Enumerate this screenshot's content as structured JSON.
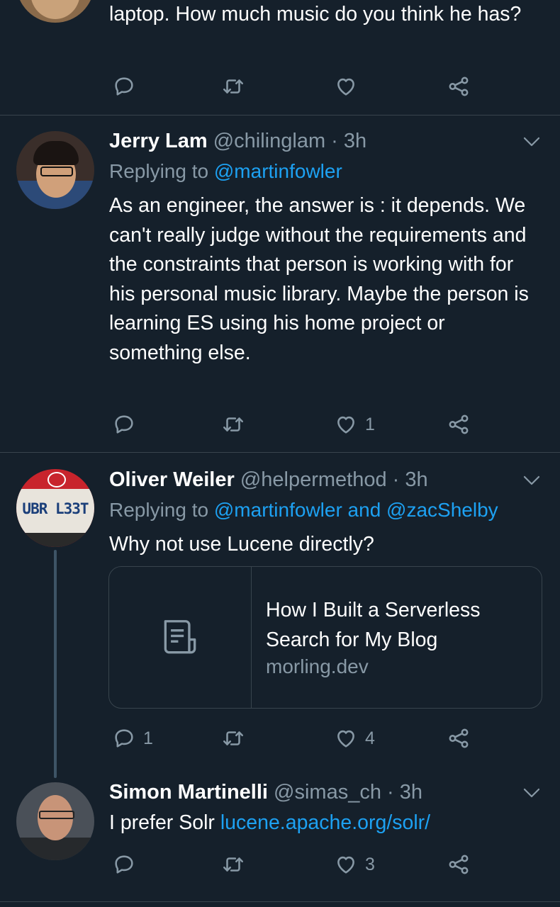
{
  "colors": {
    "background": "#15202b",
    "text": "#ffffff",
    "muted": "#8899a6",
    "link": "#1da1f2",
    "divider": "#38444d"
  },
  "tweets": [
    {
      "body": "laptop. How much music do you think he has?",
      "actions": {
        "reply_count": "",
        "retweet_count": "",
        "like_count": ""
      }
    },
    {
      "name": "Jerry Lam",
      "meta": "@chilinglam · 3h",
      "replying_prefix": "Replying to",
      "replying_to": "@martinfowler",
      "body": "As an engineer, the answer is : it depends. We can't really judge without the requirements and the constraints that person is working with for his personal music library. Maybe the person is learning ES using his home project or something else.",
      "actions": {
        "reply_count": "",
        "retweet_count": "",
        "like_count": "1"
      }
    },
    {
      "name": "Oliver Weiler",
      "meta": "@helpermethod · 3h",
      "replying_prefix": "Replying to",
      "replying_to": "@martinfowler and @zacShelby",
      "body": "Why not use Lucene directly?",
      "card": {
        "title": "How I Built a Serverless Search for My Blog",
        "domain": "morling.dev",
        "icon": "document-icon"
      },
      "avatar_plate_text": "UBR L33T",
      "actions": {
        "reply_count": "1",
        "retweet_count": "",
        "like_count": "4"
      }
    },
    {
      "name": "Simon Martinelli",
      "meta": "@simas_ch · 3h",
      "body_prefix": "I prefer Solr",
      "body_link": "lucene.apache.org/solr/",
      "actions": {
        "reply_count": "",
        "retweet_count": "",
        "like_count": "3"
      }
    }
  ]
}
